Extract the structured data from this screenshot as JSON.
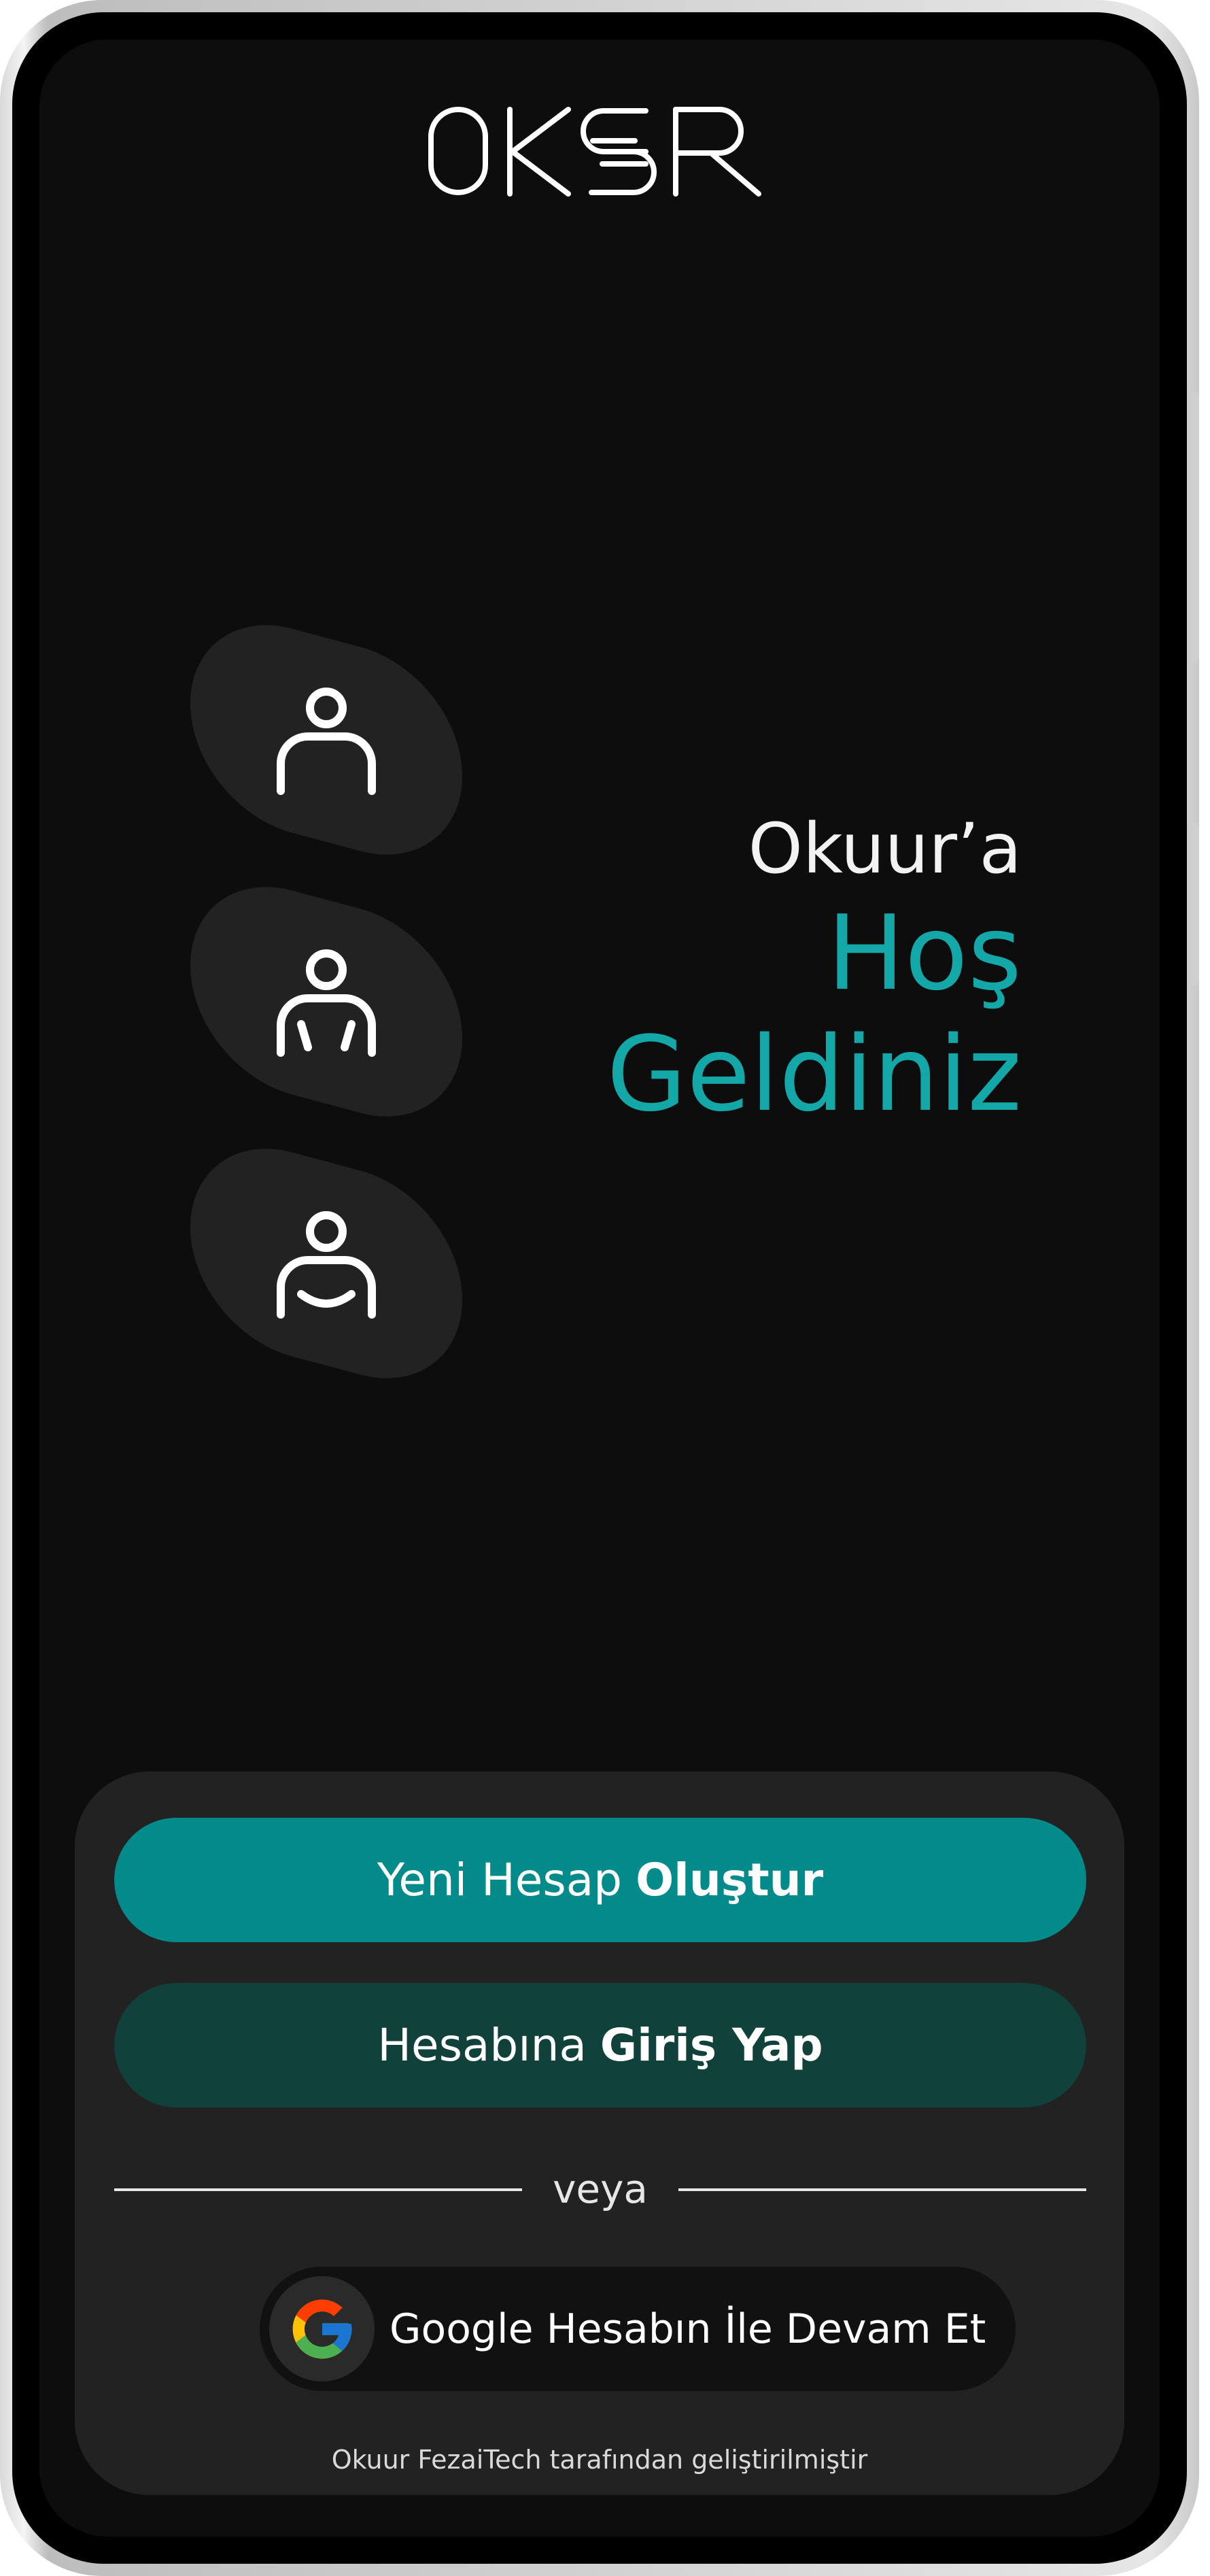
{
  "app": {
    "logo_text": "OKUUR"
  },
  "welcome": {
    "line1": "Okuur’a",
    "line2": "Hoş",
    "line3": "Geldiniz"
  },
  "avatars": [
    {
      "icon": "person-icon"
    },
    {
      "icon": "person-arms-icon"
    },
    {
      "icon": "person-smile-icon"
    }
  ],
  "actions": {
    "create_prefix": "Yeni Hesap",
    "create_bold": "Oluştur",
    "login_prefix": "Hesabına",
    "login_bold": "Giriş Yap",
    "divider": "veya",
    "google": "Google Hesabın İle Devam Et"
  },
  "footer": {
    "text": "Okuur FezaiTech tarafından geliştirilmiştir"
  },
  "colors": {
    "accent": "#14a7a8",
    "primary_button": "#038b8b",
    "secondary_button": "#10413b",
    "panel": "#222222",
    "screen_background": "#0d0d0d"
  }
}
